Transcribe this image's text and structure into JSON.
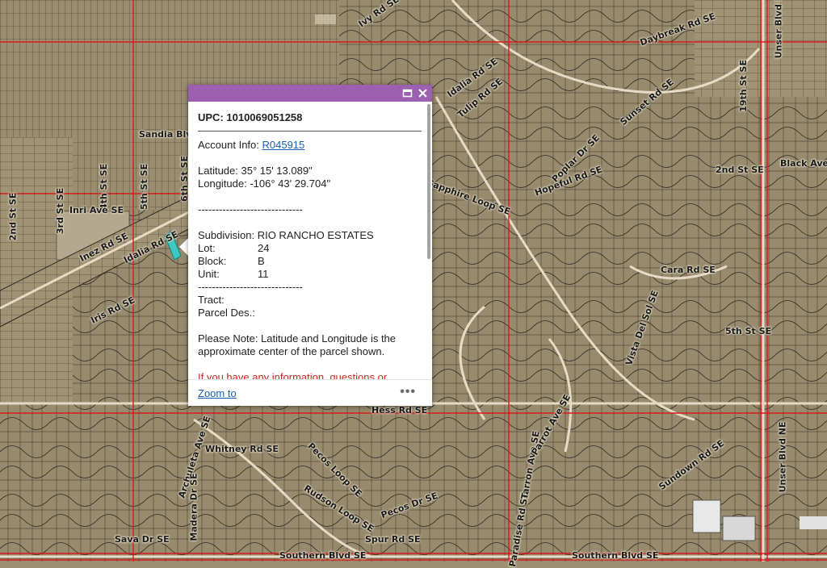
{
  "map": {
    "street_labels": [
      {
        "text": "Idalia Rd SE"
      },
      {
        "text": "Idalia Rd SE"
      },
      {
        "text": "Inez Rd SE"
      },
      {
        "text": "Iris Rd SE"
      },
      {
        "text": "Sandia Blvd SE"
      },
      {
        "text": "3rd St SE"
      },
      {
        "text": "4th St SE"
      },
      {
        "text": "5th St SE"
      },
      {
        "text": "6th St SE"
      },
      {
        "text": "2nd St SE"
      },
      {
        "text": "Inri Ave SE"
      },
      {
        "text": "Tulip Rd SE"
      },
      {
        "text": "Sunset Rd SE"
      },
      {
        "text": "Daybreak Rd SE"
      },
      {
        "text": "Poplar Dr SE"
      },
      {
        "text": "Ivy Rd SE"
      },
      {
        "text": "Hess Rd SE"
      },
      {
        "text": "Whitney Rd SE"
      },
      {
        "text": "Southern Blvd SE"
      },
      {
        "text": "Southern Blvd SE"
      },
      {
        "text": "Unser Blvd NE"
      },
      {
        "text": "Unser Blvd NE"
      },
      {
        "text": "19th St SE"
      },
      {
        "text": "2nd St SE"
      },
      {
        "text": "Black Ave SE"
      },
      {
        "text": "5th St SE"
      },
      {
        "text": "Pecos Loop SE"
      },
      {
        "text": "Sava Dr SE"
      },
      {
        "text": "Spur Rd SE"
      },
      {
        "text": "Archuleta Ave SE"
      },
      {
        "text": "Madera Dr SE"
      },
      {
        "text": "Paradise Rd SE"
      },
      {
        "text": "Sundown Rd SE"
      },
      {
        "text": "Cara Rd SE"
      },
      {
        "text": "Hopeful Rd SE"
      },
      {
        "text": "Sapphire Loop SE"
      },
      {
        "text": "Rudson Loop SE"
      },
      {
        "text": "Tarron Ave SE"
      },
      {
        "text": "Parrot Ave SE"
      },
      {
        "text": "Pecos Dr SE"
      },
      {
        "text": "Vista Del Sol SE"
      }
    ]
  },
  "popup": {
    "header_color": "#9d5fb0",
    "maximize_icon": "maximize-icon",
    "close_icon": "close-icon",
    "upc": "UPC: 1010069051258",
    "account_label": "Account Info: ",
    "account_link": "R045915",
    "latitude": "Latitude: 35° 15' 13.089\"",
    "longitude": "Longitude: -106° 43' 29.704\"",
    "separator": "------------------------------",
    "subdivision": "Subdivision: RIO RANCHO ESTATES",
    "lot_label": "Lot:",
    "lot_value": "24",
    "block_label": "Block:",
    "block_value": "B",
    "unit_label": "Unit:",
    "unit_value": "11",
    "separator2": "------------------------------",
    "tract": "Tract:",
    "parcel_des": "Parcel Des.:",
    "note": "Please Note: Latitude and Longitude is the approximate center of the parcel shown.",
    "info_text": "If you have any information, questions or comments about this parcel, please contact",
    "zoom_to": "Zoom to",
    "more": "•••"
  }
}
